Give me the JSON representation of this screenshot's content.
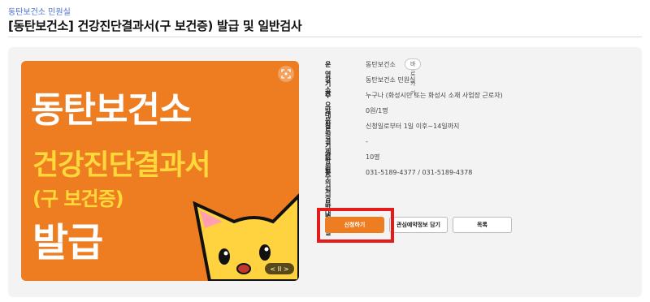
{
  "breadcrumb": "동탄보건소 민원실",
  "title": "[동탄보건소] 건강진단결과서(구 보건증) 발급 및 일반검사",
  "poster": {
    "line1": "동탄보건소",
    "line2": "건강진단결과서",
    "line3": "(구 보건증)",
    "line4": "발급",
    "pager": "<  II  >"
  },
  "info": {
    "rows": [
      {
        "label": "운영기관",
        "value": "동탄보건소"
      },
      {
        "label": "장소",
        "value": "동탄보건소 민원실"
      },
      {
        "label": "주요대상",
        "value": "누구나 (화성시민 또는 화성시 소재 사업장 근로자)"
      },
      {
        "label": "방문료",
        "value": "0원/1명"
      },
      {
        "label": "신청기간",
        "value": "신청일로부터 1일 이후~14일까지"
      },
      {
        "label": "결제방법",
        "value": "-"
      },
      {
        "label": "정원수",
        "value": "10명"
      },
      {
        "label": "문의처",
        "value": "031-5189-4377 / 031-5189-4378"
      },
      {
        "label": "선정방법",
        "value": ""
      },
      {
        "label": "부대시설",
        "value": ""
      }
    ],
    "shortcut_label": "바로가기"
  },
  "buttons": {
    "apply": "신청하기",
    "favorite": "관심예약정보 담기",
    "list": "목록"
  },
  "colors": {
    "accent": "#ee7d21",
    "highlight": "#e41b1b",
    "link": "#4a6fd1"
  }
}
